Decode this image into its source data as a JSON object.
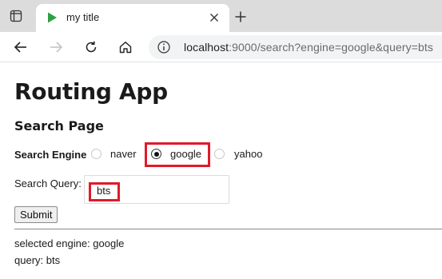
{
  "browser": {
    "tab_title": "my title",
    "address": {
      "host": "localhost",
      "rest": ":9000/search?engine=google&query=bts"
    },
    "icons": {
      "tab_actions": "tab-actions-icon",
      "favicon": "play-triangle-icon",
      "close": "close-icon",
      "new_tab": "plus-icon",
      "back": "back-arrow-icon",
      "forward": "forward-arrow-icon",
      "refresh": "refresh-icon",
      "home": "home-icon",
      "site_info": "info-icon"
    },
    "favicon_color": "#2ea043"
  },
  "page": {
    "title": "Routing App",
    "subtitle": "Search Page",
    "engine_label": "Search Engine",
    "engines": [
      {
        "label": "naver",
        "checked": false
      },
      {
        "label": "google",
        "checked": true
      },
      {
        "label": "yahoo",
        "checked": false
      }
    ],
    "query_label": "Search Query:",
    "query_value": "bts",
    "submit_label": "Submit",
    "result_engine": "selected engine: google",
    "result_query": "query: bts"
  },
  "highlight_color": "#e01a2b"
}
